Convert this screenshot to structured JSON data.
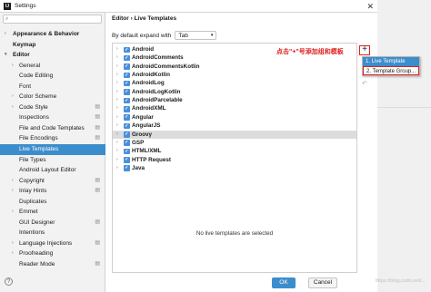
{
  "window": {
    "title": "Settings",
    "app_icon": "intellij-icon"
  },
  "breadcrumb": {
    "parent": "Editor",
    "sep": "›",
    "current": "Live Templates"
  },
  "expand_with": {
    "label": "By default expand with",
    "value": "Tab"
  },
  "sidebar": {
    "items": [
      {
        "label": "Appearance & Behavior",
        "bold": true,
        "chevron": "right",
        "gear": false
      },
      {
        "label": "Keymap",
        "bold": true,
        "chevron": "",
        "gear": false
      },
      {
        "label": "Editor",
        "bold": true,
        "chevron": "down",
        "gear": false
      },
      {
        "label": "General",
        "bold": false,
        "chevron": "right",
        "gear": false
      },
      {
        "label": "Code Editing",
        "bold": false,
        "chevron": "",
        "gear": false
      },
      {
        "label": "Font",
        "bold": false,
        "chevron": "",
        "gear": false
      },
      {
        "label": "Color Scheme",
        "bold": false,
        "chevron": "right",
        "gear": false
      },
      {
        "label": "Code Style",
        "bold": false,
        "chevron": "right",
        "gear": true
      },
      {
        "label": "Inspections",
        "bold": false,
        "chevron": "",
        "gear": true
      },
      {
        "label": "File and Code Templates",
        "bold": false,
        "chevron": "",
        "gear": true
      },
      {
        "label": "File Encodings",
        "bold": false,
        "chevron": "",
        "gear": true
      },
      {
        "label": "Live Templates",
        "bold": false,
        "chevron": "",
        "gear": false,
        "selected": true
      },
      {
        "label": "File Types",
        "bold": false,
        "chevron": "",
        "gear": false
      },
      {
        "label": "Android Layout Editor",
        "bold": false,
        "chevron": "",
        "gear": false
      },
      {
        "label": "Copyright",
        "bold": false,
        "chevron": "right",
        "gear": true
      },
      {
        "label": "Inlay Hints",
        "bold": false,
        "chevron": "right",
        "gear": true
      },
      {
        "label": "Duplicates",
        "bold": false,
        "chevron": "",
        "gear": false
      },
      {
        "label": "Emmet",
        "bold": false,
        "chevron": "right",
        "gear": false
      },
      {
        "label": "GUI Designer",
        "bold": false,
        "chevron": "",
        "gear": true
      },
      {
        "label": "Intentions",
        "bold": false,
        "chevron": "",
        "gear": false
      },
      {
        "label": "Language Injections",
        "bold": false,
        "chevron": "right",
        "gear": true
      },
      {
        "label": "Proofreading",
        "bold": false,
        "chevron": "right",
        "gear": false
      },
      {
        "label": "Reader Mode",
        "bold": false,
        "chevron": "",
        "gear": true
      }
    ]
  },
  "templates": {
    "groups": [
      "Android",
      "AndroidComments",
      "AndroidCommentsKotlin",
      "AndroidKotlin",
      "AndroidLog",
      "AndroidLogKotlin",
      "AndroidParcelable",
      "AndroidXML",
      "Angular",
      "AngularJS",
      "Groovy",
      "GSP",
      "HTML/XML",
      "HTTP Request",
      "Java"
    ],
    "highlighted_index": 10,
    "empty_text": "No live templates are selected"
  },
  "annotation": {
    "text": "点击\"+\"号添加组和模板"
  },
  "toolbar": {
    "add_label": "+",
    "undo_icon": "undo-icon"
  },
  "popup": {
    "items": [
      {
        "label": "1. Live Template",
        "selected": true
      },
      {
        "label": "2. Template Group...",
        "selected": false
      }
    ]
  },
  "footer": {
    "ok": "OK",
    "cancel": "Cancel",
    "help": "?"
  },
  "watermark": "https://blog.csdn.net/...",
  "colors": {
    "accent": "#3c8dcc",
    "annotation": "#e02020",
    "checkbox": "#4a8fd9"
  }
}
